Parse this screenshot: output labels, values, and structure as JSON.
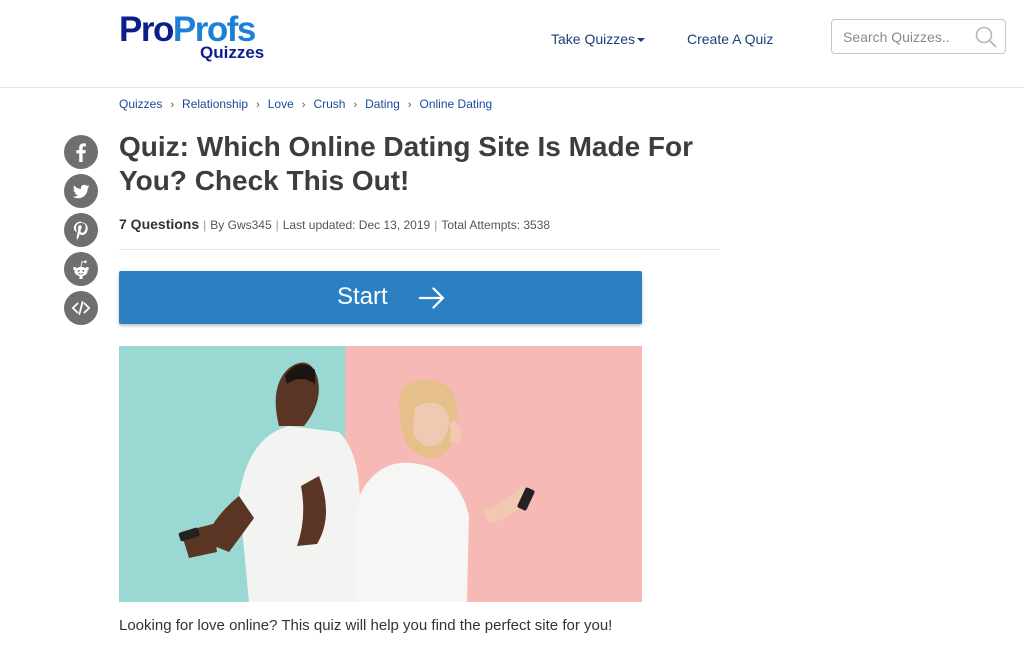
{
  "header": {
    "logo": {
      "pro1": "Pro",
      "pro2": "Profs",
      "sub": "Quizzes"
    },
    "nav": {
      "take_quizzes": "Take Quizzes",
      "create_quiz": "Create A Quiz"
    },
    "search": {
      "placeholder": "Search Quizzes.."
    }
  },
  "breadcrumb": {
    "items": [
      "Quizzes",
      "Relationship",
      "Love",
      "Crush",
      "Dating",
      "Online Dating"
    ],
    "separator": "›"
  },
  "social": [
    "facebook-icon",
    "twitter-icon",
    "pinterest-icon",
    "reddit-icon",
    "embed-code-icon"
  ],
  "quiz": {
    "title": "Quiz: Which Online Dating Site Is Made For You? Check This Out!",
    "questions": "7 Questions",
    "author": "By Gws345",
    "updated": "Last updated: Dec 13, 2019",
    "attempts": "Total Attempts: 3538",
    "start_label": "Start",
    "description": "Looking for love online? This quiz will help you find the perfect site for you!"
  },
  "colors": {
    "brand_dark": "#0c1e8c",
    "brand_light": "#1e7fd6",
    "start_button": "#2b7fc3",
    "hero_left": "#9ad9d3",
    "hero_right": "#f7b9b5",
    "social_icon": "#6f6f6f"
  }
}
